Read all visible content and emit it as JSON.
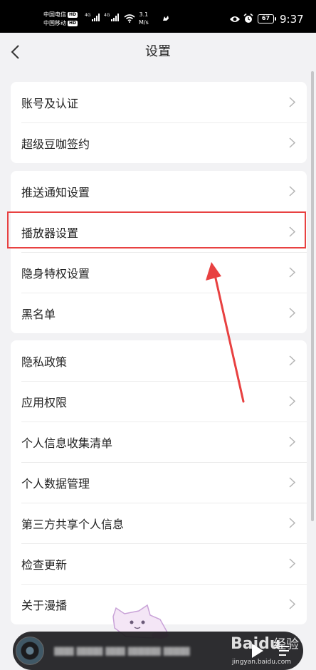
{
  "status_bar": {
    "carrier1": "中国电信",
    "carrier2": "中国移动",
    "hd": "HD",
    "net_type": "4G",
    "speed_value": "3.1",
    "speed_unit": "M/s",
    "battery": "67",
    "time": "9:37"
  },
  "nav": {
    "title": "设置"
  },
  "groups": [
    {
      "items": [
        {
          "label": "账号及认证"
        },
        {
          "label": "超级豆咖签约"
        }
      ]
    },
    {
      "items": [
        {
          "label": "推送通知设置"
        },
        {
          "label": "播放器设置"
        },
        {
          "label": "隐身特权设置"
        },
        {
          "label": "黑名单"
        }
      ]
    },
    {
      "items": [
        {
          "label": "隐私政策"
        },
        {
          "label": "应用权限"
        },
        {
          "label": "个人信息收集清单"
        },
        {
          "label": "个人数据管理"
        },
        {
          "label": "第三方共享个人信息"
        },
        {
          "label": "检查更新"
        },
        {
          "label": "关于漫播"
        }
      ]
    }
  ],
  "player": {
    "song": "▇▇▇ ▇▇▇▇ ▇▇▇ ▇▇▇▇▇ ▇▇▇▇"
  },
  "watermark": {
    "logo": "Baidu",
    "jingyan": "经验",
    "url": "jingyan.baidu.com"
  },
  "colors": {
    "accent_highlight": "#e84141",
    "background": "#f2f2f4",
    "card": "#ffffff"
  }
}
